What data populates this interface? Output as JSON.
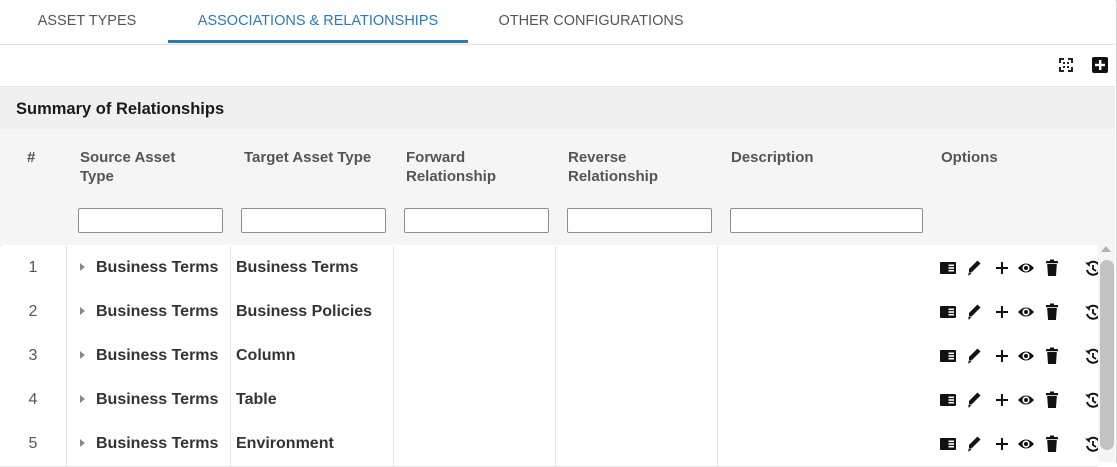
{
  "tabs": [
    {
      "label": "ASSET TYPES",
      "active": false
    },
    {
      "label": "ASSOCIATIONS & RELATIONSHIPS",
      "active": true
    },
    {
      "label": "OTHER CONFIGURATIONS",
      "active": false
    }
  ],
  "toolbar": {
    "expand_icon": "expand-icon",
    "add_icon": "add-square-icon"
  },
  "summary": {
    "title": "Summary of Relationships"
  },
  "columns": [
    {
      "label": "#"
    },
    {
      "label": "Source Asset Type",
      "line1": "Source Asset",
      "line2": "Type"
    },
    {
      "label": "Target Asset Type"
    },
    {
      "label": "Forward Relationship",
      "line1": "Forward",
      "line2": "Relationship"
    },
    {
      "label": "Reverse Relationship",
      "line1": "Reverse",
      "line2": "Relationship"
    },
    {
      "label": "Description"
    },
    {
      "label": "Options"
    }
  ],
  "filters": {
    "source": "",
    "target": "",
    "forward": "",
    "reverse": "",
    "description": ""
  },
  "rows": [
    {
      "num": "1",
      "source": "Business Terms",
      "target": "Business Terms",
      "forward": "",
      "reverse": "",
      "description": ""
    },
    {
      "num": "2",
      "source": "Business Terms",
      "target": "Business Policies",
      "forward": "",
      "reverse": "",
      "description": ""
    },
    {
      "num": "3",
      "source": "Business Terms",
      "target": "Column",
      "forward": "",
      "reverse": "",
      "description": ""
    },
    {
      "num": "4",
      "source": "Business Terms",
      "target": "Table",
      "forward": "",
      "reverse": "",
      "description": ""
    },
    {
      "num": "5",
      "source": "Business Terms",
      "target": "Environment",
      "forward": "",
      "reverse": "",
      "description": ""
    }
  ],
  "row_options": [
    "details-icon",
    "edit-icon",
    "add-icon",
    "view-icon",
    "delete-icon",
    "history-icon"
  ],
  "colors": {
    "accent": "#2c7ab4",
    "summary_bg": "#f0f0f0",
    "header_bg": "#f5f5f5",
    "icon": "#111111"
  }
}
